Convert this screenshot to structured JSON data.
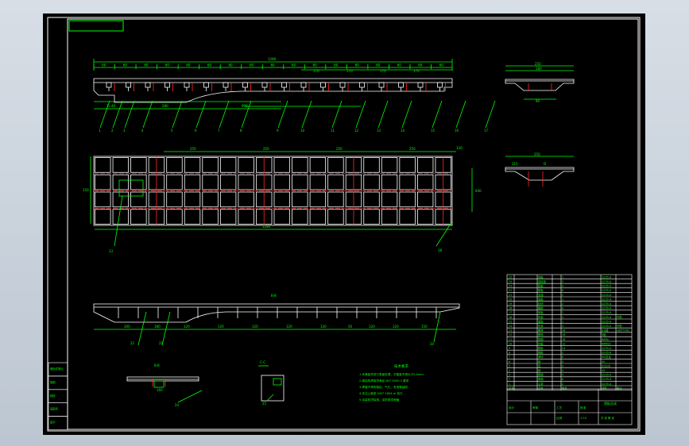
{
  "colors": {
    "frame": "#ffffff",
    "green": "#00ff00",
    "red": "#ff2a2a",
    "white": "#ffffff",
    "bg": "#000000"
  },
  "top_view": {
    "overall_dim": "1280",
    "segment_dims": [
      "60",
      "60",
      "60",
      "60",
      "60",
      "60",
      "60",
      "60",
      "60",
      "60",
      "60",
      "60",
      "60",
      "60",
      "60",
      "60",
      "60"
    ],
    "sub_dims": [
      "170",
      "170",
      "170",
      "170"
    ],
    "lower_dims": [
      "1=40",
      "280",
      "990"
    ],
    "part_numbers": [
      "1",
      "2",
      "3",
      "4",
      "5",
      "6",
      "7",
      "8",
      "9",
      "10",
      "11",
      "12",
      "13",
      "14",
      "15",
      "16",
      "17"
    ]
  },
  "plan_view": {
    "pitch_dims": [
      "250",
      "250",
      "250",
      "250"
    ],
    "right_dim": "120",
    "bottom_dim": "1280",
    "height_dim": "640",
    "left_dim": "150",
    "callouts": [
      "13",
      "18"
    ]
  },
  "section_view": {
    "title": "B-B",
    "dims": [
      "300",
      "180",
      "120",
      "120",
      "120",
      "120",
      "120",
      "50",
      "120",
      "120",
      "150"
    ],
    "callouts": [
      "20",
      "21",
      "22"
    ]
  },
  "end_view_top": {
    "dims": [
      "250",
      "180",
      "90"
    ]
  },
  "end_view_mid": {
    "title": "D",
    "dims": [
      "250",
      "115"
    ]
  },
  "small_section": {
    "title": "B-B",
    "dim": "160",
    "callout": "24"
  },
  "small_detail": {
    "title": "C-C",
    "callout": "25"
  },
  "tech_notes": {
    "title": "技术要求",
    "lines": [
      "1.本滑板须进行表面处理，平整度不得大于0.5mm",
      "2.钢结构焊接须满足 JB/T 5000.3 要求",
      "3.焊缝不得有裂纹、气孔、夹渣等缺陷",
      "4.未注公差按 GB/T 1804-m 执行",
      "5.涂装前须除锈，涂防锈漆两遍"
    ]
  },
  "bom_rows": [
    [
      "25",
      "挡板",
      "1",
      "Q235-A",
      ""
    ],
    [
      "24",
      "连接板",
      "2",
      "Q235-A",
      ""
    ],
    [
      "23",
      "垫板",
      "4",
      "Q235-A",
      ""
    ],
    [
      "22",
      "筋板",
      "6",
      "Q235-A",
      ""
    ],
    [
      "21",
      "支座",
      "2",
      "Q235-A",
      ""
    ],
    [
      "20",
      "底板",
      "1",
      "Q235-A",
      ""
    ],
    [
      "19",
      "挡块",
      "2",
      "Q235-A",
      ""
    ],
    [
      "18",
      "横梁",
      "8",
      "Q235-A",
      ""
    ],
    [
      "17",
      "侧板",
      "2",
      "Q235-A",
      ""
    ],
    [
      "16",
      "纵梁",
      "4",
      "Q235-A",
      "外购"
    ],
    [
      "15",
      "面板",
      "1",
      "Q235-A",
      ""
    ],
    [
      "14",
      "吊耳",
      "4",
      "Q235-A",
      "外购"
    ],
    [
      "13",
      "螺栓",
      "16",
      "8.8级",
      "GB/T5782"
    ],
    [
      "12",
      "螺母",
      "16",
      "8级",
      ""
    ],
    [
      "11",
      "垫圈",
      "16",
      "65Mn",
      ""
    ],
    [
      "10",
      "衬板",
      "12",
      "NM400",
      ""
    ],
    [
      "9",
      "筋板",
      "24",
      "Q235-A",
      ""
    ],
    [
      "8",
      "端板",
      "2",
      "Q235-A",
      ""
    ],
    [
      "7",
      "滑块",
      "8",
      "MC尼龙",
      ""
    ],
    [
      "6",
      "轴",
      "4",
      "45",
      ""
    ],
    [
      "5",
      "套",
      "4",
      "ZQSn6",
      ""
    ],
    [
      "4",
      "销",
      "4",
      "45",
      ""
    ],
    [
      "3",
      "槽钢",
      "4",
      "Q235-A",
      ""
    ],
    [
      "2",
      "角钢",
      "6",
      "Q235-A",
      ""
    ],
    [
      "1",
      "主梁",
      "2",
      "Q235-A",
      ""
    ]
  ],
  "bom_header": [
    "序号",
    "名称",
    "数量",
    "材料",
    "备注"
  ],
  "title_block": {
    "drawing_name": "滑板总成",
    "labels": [
      "设计",
      "审核",
      "工艺",
      "批准"
    ],
    "scale_label": "比例",
    "scale": "1:10",
    "sheet_label": "共 张 第 张"
  },
  "left_strip": [
    "借用件登记",
    "描图",
    "描校",
    "底图号",
    "签字"
  ]
}
